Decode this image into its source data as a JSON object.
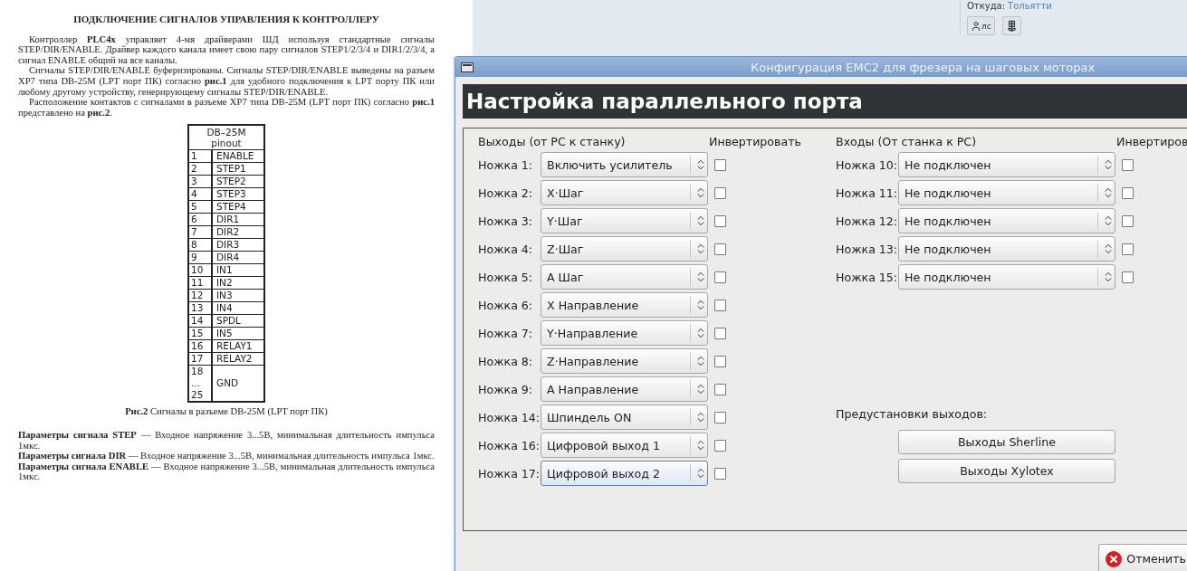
{
  "document": {
    "title": "ПОДКЛЮЧЕНИЕ СИГНАЛОВ УПРАВЛЕНИЯ К КОНТРОЛЛЕРУ",
    "paragraphs": [
      "Контроллер **PLC4x** управляет 4-мя драйверами ШД используя стандартные сигналы STEP/DIR/ENABLE. Драйвер каждого канала имеет свою пару сигналов STEP1/2/3/4 и DIR1/2/3/4, а сигнал ENABLE общий на все каналы.",
      "Сигналы STEP/DIR/ENABLE буферизированы. Сигналы STEP/DIR/ENABLE выведены на разъем XP7 типа DB-25M (LPT порт ПК) согласно **рис.1** для удобного подключения к LPT порту ПК или любому другому устройству, генерирующему сигналы STEP/DIR/ENABLE.",
      "Расположение контактов с сигналами в разъеме XP7 типа DB-25M (LPT порт ПК) согласно **рис.1** представлено на **рис.2**."
    ],
    "pinout": {
      "header": "DB–25M\npinout",
      "rows": [
        {
          "pin": "1",
          "signal": "ENABLE"
        },
        {
          "pin": "2",
          "signal": "STEP1"
        },
        {
          "pin": "3",
          "signal": "STEP2"
        },
        {
          "pin": "4",
          "signal": "STEP3"
        },
        {
          "pin": "5",
          "signal": "STEP4"
        },
        {
          "pin": "6",
          "signal": "DIR1"
        },
        {
          "pin": "7",
          "signal": "DIR2"
        },
        {
          "pin": "8",
          "signal": "DIR3"
        },
        {
          "pin": "9",
          "signal": "DIR4"
        },
        {
          "pin": "10",
          "signal": "IN1"
        },
        {
          "pin": "11",
          "signal": "IN2"
        },
        {
          "pin": "12",
          "signal": "IN3"
        },
        {
          "pin": "13",
          "signal": "IN4"
        },
        {
          "pin": "14",
          "signal": "SPDL"
        },
        {
          "pin": "15",
          "signal": "IN5"
        },
        {
          "pin": "16",
          "signal": "RELAY1"
        },
        {
          "pin": "17",
          "signal": "RELAY2"
        },
        {
          "pin": "18\n...\n25",
          "signal": "GND"
        }
      ]
    },
    "caption": "**Рис.2** Сигналы в разъеме DB-25M (LPT порт ПК)",
    "params": [
      "**Параметры сигнала STEP** — Входное напряжение 3...5В, минимальная длительность импульса 1мкс.",
      "**Параметры сигнала DIR** — Входное напряжение 3...5В, минимальная длительность импульса 1мкс.",
      "**Параметры сигнала ENABLE** — Входное напряжение 3...5В, минимальная длительность импульса 1мкс."
    ]
  },
  "forum": {
    "from_label": "Откуда:",
    "from_value": "Тольятти",
    "pm_button": "лс"
  },
  "window": {
    "title": "Конфигурация EMC2 для фрезера на шаговых моторах",
    "heading": "Настройка параллельного порта",
    "outputs": {
      "header": "Выходы (от PC к станку)",
      "invert_header": "Инвертировать",
      "pins": [
        {
          "label": "Ножка 1:",
          "value": "Включить усилитель",
          "inverted": false,
          "focused": false
        },
        {
          "label": "Ножка 2:",
          "value": "X·Шаг",
          "inverted": false,
          "focused": false
        },
        {
          "label": "Ножка 3:",
          "value": "Y·Шаг",
          "inverted": false,
          "focused": false
        },
        {
          "label": "Ножка 4:",
          "value": "Z·Шаг",
          "inverted": false,
          "focused": false
        },
        {
          "label": "Ножка 5:",
          "value": "A Шаг",
          "inverted": false,
          "focused": false
        },
        {
          "label": "Ножка 6:",
          "value": "X Направление",
          "inverted": false,
          "focused": false
        },
        {
          "label": "Ножка 7:",
          "value": "Y·Направление",
          "inverted": false,
          "focused": false
        },
        {
          "label": "Ножка 8:",
          "value": "Z·Направление",
          "inverted": false,
          "focused": false
        },
        {
          "label": "Ножка 9:",
          "value": "A Направление",
          "inverted": false,
          "focused": false
        },
        {
          "label": "Ножка 14:",
          "value": "Шпиндель ON",
          "inverted": false,
          "focused": false
        },
        {
          "label": "Ножка 16:",
          "value": "Цифровой выход 1",
          "inverted": false,
          "focused": false
        },
        {
          "label": "Ножка 17:",
          "value": "Цифровой выход 2",
          "inverted": false,
          "focused": true
        }
      ]
    },
    "inputs": {
      "header": "Входы (От станка к PC)",
      "invert_header": "Инвертиров",
      "pins": [
        {
          "label": "Ножка 10:",
          "value": "Не подключен",
          "inverted": false,
          "focused": false
        },
        {
          "label": "Ножка 11:",
          "value": "Не подключен",
          "inverted": false,
          "focused": false
        },
        {
          "label": "Ножка 12:",
          "value": "Не подключен",
          "inverted": false,
          "focused": false
        },
        {
          "label": "Ножка 13:",
          "value": "Не подключен",
          "inverted": false,
          "focused": false
        },
        {
          "label": "Ножка 15:",
          "value": "Не подключен",
          "inverted": false,
          "focused": false
        }
      ]
    },
    "presets": {
      "label": "Предустановки выходов:",
      "buttons": [
        "Выходы Sherline",
        "Выходы Xylotex"
      ]
    },
    "cancel": {
      "label": "Отменить"
    }
  }
}
